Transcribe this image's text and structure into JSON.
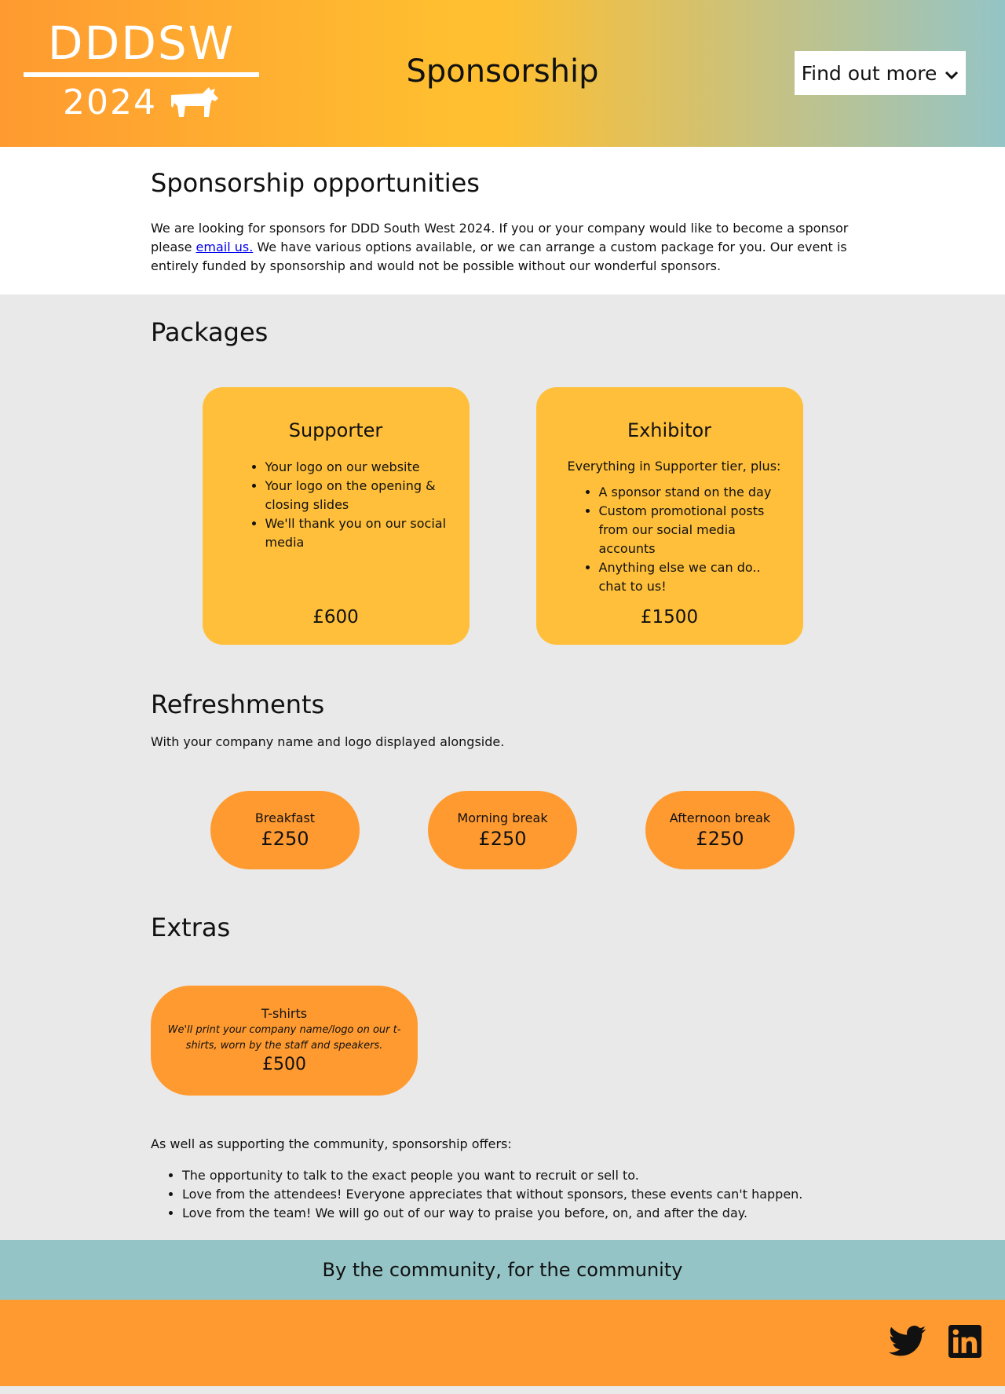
{
  "header": {
    "logo_text": "DDDSW",
    "logo_year": "2024",
    "page_title": "Sponsorship",
    "findout_label": "Find out more"
  },
  "intro": {
    "heading": "Sponsorship opportunities",
    "text_before_link": "We are looking for sponsors for DDD South West 2024. If you or your company would like to become a sponsor please ",
    "link_text": "email us.",
    "text_after_link": " We have various options available, or we can arrange a custom package for you. Our event is entirely funded by sponsorship and would not be possible without our wonderful sponsors."
  },
  "packages": {
    "heading": "Packages",
    "items": [
      {
        "title": "Supporter",
        "intro": "",
        "features": [
          "Your logo on our website",
          "Your logo on the opening & closing slides",
          "We'll thank you on our social media"
        ],
        "price": "£600"
      },
      {
        "title": "Exhibitor",
        "intro": "Everything in Supporter tier, plus:",
        "features": [
          "A sponsor stand on the day",
          "Custom promotional posts from our social media accounts",
          "Anything else we can do.. chat to us!"
        ],
        "price": "£1500"
      }
    ]
  },
  "refreshments": {
    "heading": "Refreshments",
    "text": "With your company name and logo displayed alongside.",
    "items": [
      {
        "label": "Breakfast",
        "price": "£250"
      },
      {
        "label": "Morning break",
        "price": "£250"
      },
      {
        "label": "Afternoon break",
        "price": "£250"
      }
    ]
  },
  "extras": {
    "heading": "Extras",
    "item": {
      "title": "T-shirts",
      "description": "We'll print your company name/logo on our t-shirts, worn by the staff and speakers.",
      "price": "£500"
    }
  },
  "offers": {
    "intro": "As well as supporting the community, sponsorship offers:",
    "items": [
      "The opportunity to talk to the exact people you want to recruit or sell to.",
      "Love from the attendees! Everyone appreciates that without sponsors, these events can't happen.",
      "Love from the team! We will go out of our way to praise you before, on, and after the day."
    ]
  },
  "tagline": "By the community, for the community",
  "social": {
    "icons": [
      "twitter-icon",
      "linkedin-icon"
    ]
  },
  "colors": {
    "orange": "#ff9a30",
    "yellow": "#ffbf3a",
    "teal": "#95c4c6",
    "grey": "#e9e9e9",
    "link": "#0000ee"
  }
}
